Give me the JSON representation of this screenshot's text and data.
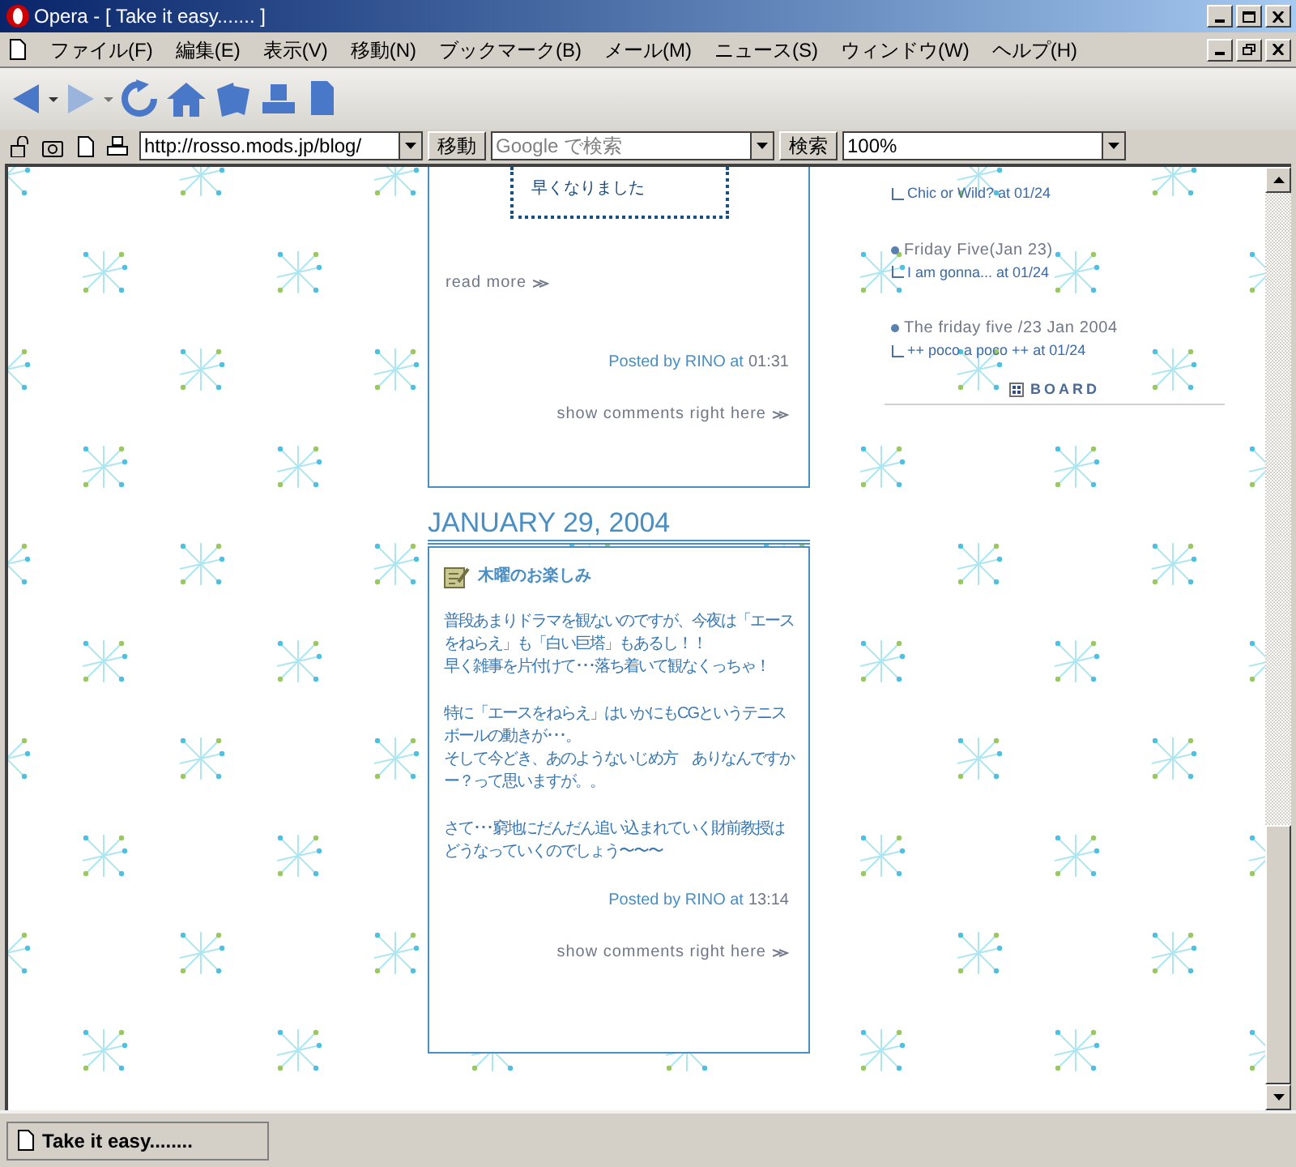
{
  "window": {
    "title": "Opera - [ Take it easy....... ]"
  },
  "menu": [
    "ファイル(F)",
    "編集(E)",
    "表示(V)",
    "移動(N)",
    "ブックマーク(B)",
    "メール(M)",
    "ニュース(S)",
    "ウィンドウ(W)",
    "ヘルプ(H)"
  ],
  "address": {
    "url": "http://rosso.mods.jp/blog/",
    "go": "移動"
  },
  "search": {
    "placeholder": "Google で検索",
    "button": "検索"
  },
  "zoom": "100%",
  "first_post": {
    "quote": "早くなりました",
    "read_more": "read more",
    "posted": "Posted by RINO at",
    "time": "01:31",
    "comments": "show comments right here"
  },
  "date": "JANUARY 29, 2004",
  "post": {
    "title": "木曜のお楽しみ",
    "paragraphs": [
      [
        "普段あまりドラマを観ないのですが、今夜は「エースをねらえ」も「白い巨塔」もあるし！！",
        "早く雑事を片付けて･･･落ち着いて観なくっちゃ！"
      ],
      [
        "特に「エースをねらえ」はいかにもCGというテニスボールの動きが･･･。",
        "そして今どき、あのようないじめ方　ありなんですかー？って思いますが。。"
      ],
      [
        "さて･･･窮地にだんだん追い込まれていく財前教授はどうなっていくのでしょう〜〜〜"
      ]
    ],
    "posted": "Posted by RINO at",
    "time": "13:14",
    "comments": "show comments right here"
  },
  "sidebar": {
    "recent": [
      {
        "comment": "Chic or Wild? at 01/24"
      },
      {
        "title": "Friday Five(Jan 23)",
        "comment": "I am gonna... at 01/24"
      },
      {
        "title": "The friday five /23 Jan 2004",
        "comment": "++ poco a poco ++ at 01/24"
      }
    ],
    "board": "BOARD"
  },
  "status_bar": {
    "text": "Take it easy........"
  }
}
